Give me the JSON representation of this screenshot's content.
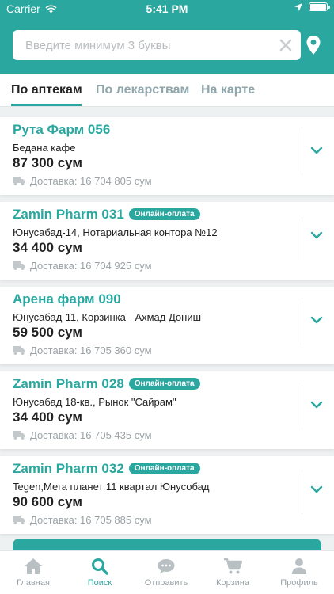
{
  "status": {
    "carrier": "Carrier",
    "time": "5:41 PM"
  },
  "search": {
    "placeholder": "Введите минимум 3 буквы",
    "value": ""
  },
  "tabs": [
    {
      "label": "По аптекам",
      "active": true
    },
    {
      "label": "По лекарствам",
      "active": false
    },
    {
      "label": "На карте",
      "active": false
    }
  ],
  "pharmacies": [
    {
      "name": "Рута Фарм 056",
      "badge": "",
      "address": "Бедана кафе",
      "price": "87 300 сум",
      "delivery": "Доставка: 16 704 805 сум"
    },
    {
      "name": "Zamin Pharm 031",
      "badge": "Онлайн-оплата",
      "address": "Юнусабад-14, Нотариальная контора №12",
      "price": "34 400 сум",
      "delivery": "Доставка: 16 704 925 сум"
    },
    {
      "name": "Арена фарм 090",
      "badge": "",
      "address": "Юнусабад-11, Корзинка - Ахмад Дониш",
      "price": "59 500 сум",
      "delivery": "Доставка: 16 705 360 сум"
    },
    {
      "name": "Zamin Pharm 028",
      "badge": "Онлайн-оплата",
      "address": "Юнусабад 18-кв., Рынок \"Сайрам\"",
      "price": "34 400 сум",
      "delivery": "Доставка: 16 705 435 сум"
    },
    {
      "name": "Zamin Pharm 032",
      "badge": "Онлайн-оплата",
      "address": "Tegen,Мега планет 11 квартал Юнусобад",
      "price": "90 600 сум",
      "delivery": "Доставка: 16 705 885 сум"
    }
  ],
  "tabbar": [
    {
      "label": "Главная",
      "icon": "home-icon",
      "active": false
    },
    {
      "label": "Поиск",
      "icon": "search-icon",
      "active": true
    },
    {
      "label": "Отправить",
      "icon": "chat-icon",
      "active": false
    },
    {
      "label": "Корзина",
      "icon": "cart-icon",
      "active": false
    },
    {
      "label": "Профиль",
      "icon": "profile-icon",
      "active": false
    }
  ],
  "colors": {
    "accent": "#2aa8a0",
    "inactive": "#9aa2a5",
    "text": "#222222"
  }
}
